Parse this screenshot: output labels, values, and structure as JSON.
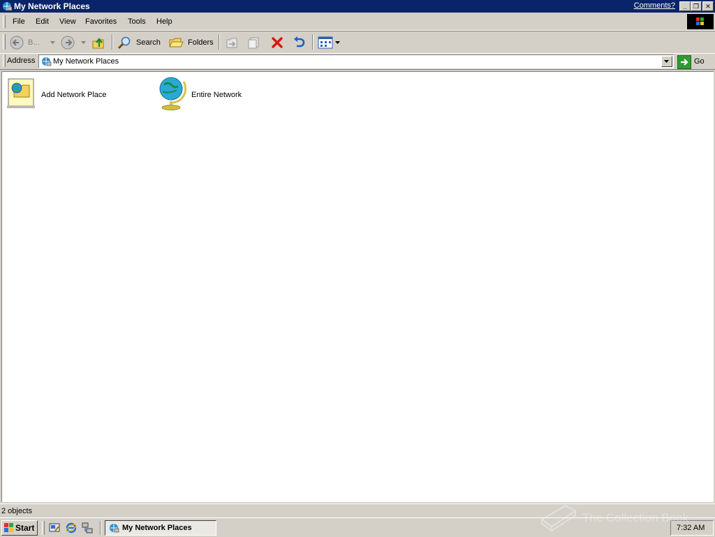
{
  "window": {
    "title": "My Network Places",
    "comments_link": "Comments?",
    "controls": [
      "minimize",
      "restore",
      "close"
    ]
  },
  "menu": {
    "items": [
      {
        "label": "File"
      },
      {
        "label": "Edit"
      },
      {
        "label": "View"
      },
      {
        "label": "Favorites"
      },
      {
        "label": "Tools"
      },
      {
        "label": "Help"
      }
    ]
  },
  "toolbar": {
    "back_label": "B...",
    "search_label": "Search",
    "folders_label": "Folders"
  },
  "address": {
    "label": "Address",
    "value": "My Network Places",
    "go_label": "Go"
  },
  "items": [
    {
      "label": "Add Network Place",
      "icon": "add-network-place-icon"
    },
    {
      "label": "Entire Network",
      "icon": "globe-icon"
    }
  ],
  "status": {
    "text": "2 objects"
  },
  "taskbar": {
    "start_label": "Start",
    "task_label": "My Network Places",
    "time": "7:32 AM"
  },
  "watermark": {
    "text": "The Collection Book"
  },
  "colors": {
    "titlebar": "#0a246a",
    "chrome": "#d4d0c8",
    "content_bg": "#ffffff"
  }
}
